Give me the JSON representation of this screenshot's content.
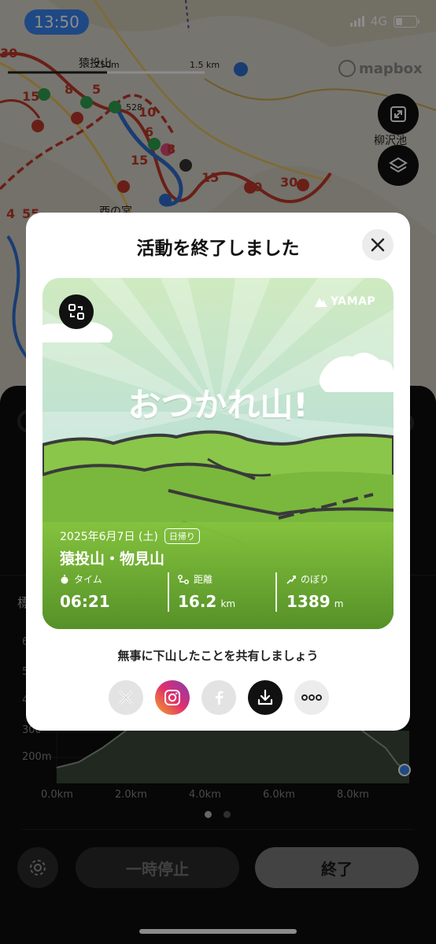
{
  "status_bar": {
    "time": "13:50",
    "network": "4G"
  },
  "map": {
    "attribution": "mapbox",
    "scale_label": "1.5 km",
    "scale_label_small": "750m",
    "labels": [
      "猿投山",
      "柳沢池",
      "西の宮"
    ],
    "trail_numbers": [
      "30",
      "15",
      "8",
      "5",
      "10",
      "6",
      "15",
      "8",
      "15",
      "10",
      "30",
      "4",
      "55"
    ],
    "peak_label": "528"
  },
  "panel": {
    "chart": {
      "y_ticks": [
        "200m",
        "300",
        "4",
        "5",
        "6"
      ],
      "x_ticks": [
        "0.0km",
        "2.0km",
        "4.0km",
        "6.0km",
        "8.0km"
      ],
      "left_label": "標"
    },
    "pause_label": "一時停止",
    "end_label": "終了"
  },
  "modal": {
    "title": "活動を終了しました",
    "share_prompt": "無事に下山したことを共有しましょう",
    "card": {
      "brand": "YAMAP",
      "headline": "おつかれ山!",
      "date": "2025年6月7日 (土)",
      "trip_type": "日帰り",
      "route": "猿投山・物見山",
      "stats": [
        {
          "label": "タイム",
          "value": "06:21",
          "unit": ""
        },
        {
          "label": "距離",
          "value": "16.2",
          "unit": "km"
        },
        {
          "label": "のぼり",
          "value": "1389",
          "unit": "m"
        }
      ]
    },
    "share_icons": [
      "x-icon",
      "instagram-icon",
      "facebook-icon",
      "download-icon",
      "more-icon"
    ]
  },
  "colors": {
    "accent_blue": "#3a86f2",
    "hill_green": "#7cbc3a",
    "sky": "#a9d6ea"
  }
}
